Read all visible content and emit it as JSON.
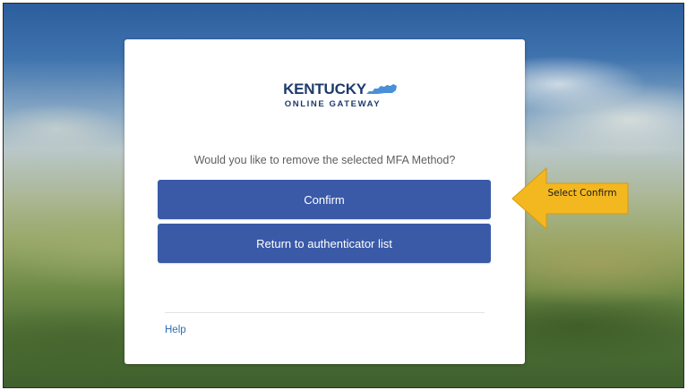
{
  "logo": {
    "line1": "KENTUCKY",
    "line2": "ONLINE GATEWAY"
  },
  "dialog": {
    "prompt": "Would you like to remove the selected MFA Method?",
    "confirm_label": "Confirm",
    "return_label": "Return to authenticator list",
    "help_label": "Help"
  },
  "annotation": {
    "label": "Select Confirm",
    "color": "#f3b81f"
  },
  "colors": {
    "button": "#3a5aa8",
    "logo_text": "#1d3a6e",
    "logo_state": "#4a90d9",
    "link": "#2f6db5"
  }
}
